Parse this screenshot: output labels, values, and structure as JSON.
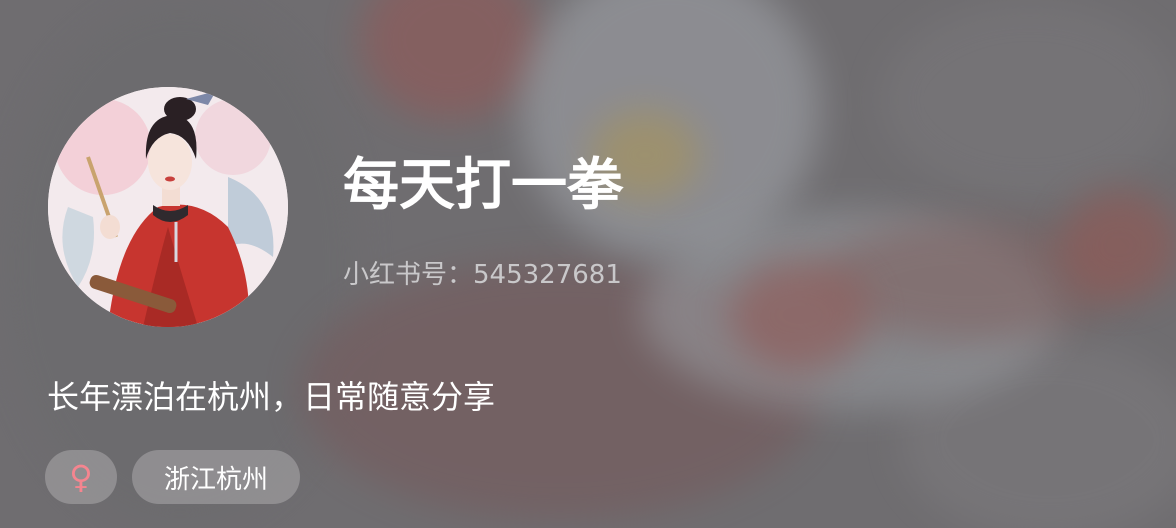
{
  "profile": {
    "nickname": "每天打一拳",
    "account_label": "小红书号：",
    "account_id": "545327681",
    "bio": "长年漂泊在杭州，日常随意分享",
    "gender_icon": "♀",
    "location": "浙江杭州"
  },
  "colors": {
    "gender_accent": "#f5858f",
    "nickname_text": "#ffffff",
    "account_text": "#c9c8ca"
  }
}
